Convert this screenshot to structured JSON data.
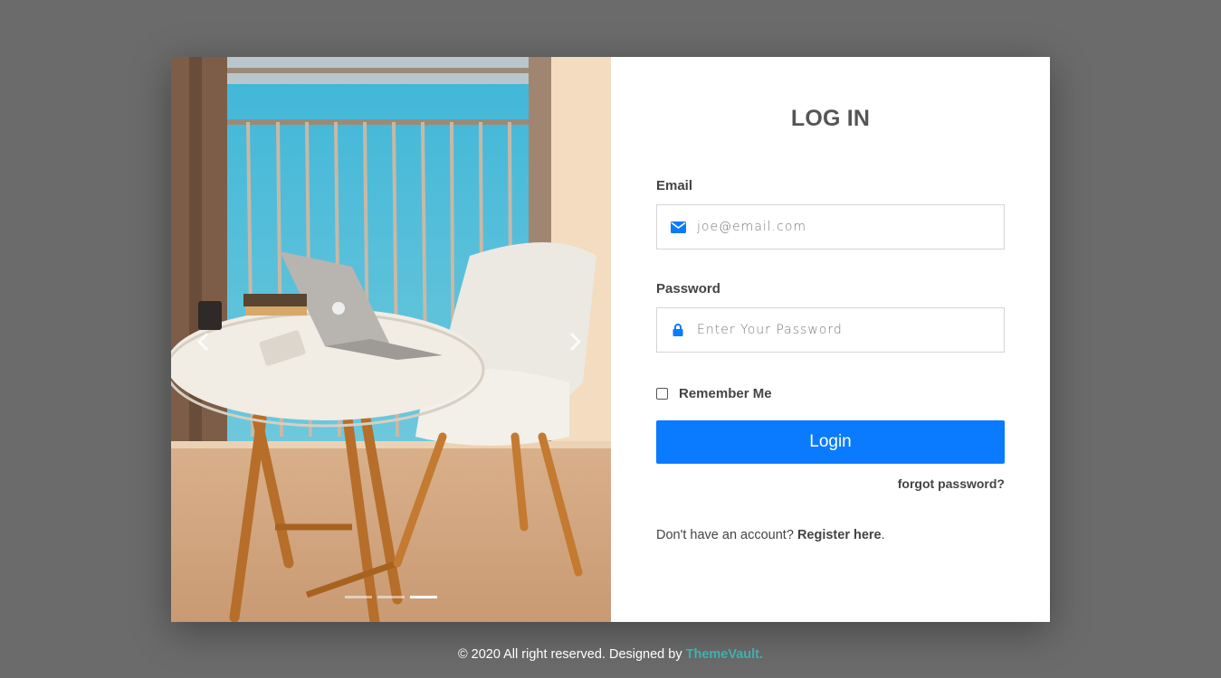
{
  "carousel": {
    "prev_icon": "chevron-left-icon",
    "next_icon": "chevron-right-icon",
    "slide_count": 3,
    "active_slide": 3
  },
  "form": {
    "title": "LOG IN",
    "email": {
      "label": "Email",
      "placeholder": "joe@email.com",
      "icon": "envelope-icon",
      "value": ""
    },
    "password": {
      "label": "Password",
      "placeholder": "Enter Your Password",
      "icon": "lock-icon",
      "value": ""
    },
    "remember_label": "Remember Me",
    "remember_checked": false,
    "login_label": "Login",
    "forgot_label": "forgot password?",
    "register_prompt": "Don't have an account?",
    "register_link": "Register here",
    "register_suffix": "."
  },
  "footer": {
    "text": "© 2020 All right reserved. Designed by",
    "brand": "ThemeVault."
  },
  "colors": {
    "background": "#6b6b6b",
    "accent": "#0a7bff",
    "brand": "#3fb0b0"
  }
}
